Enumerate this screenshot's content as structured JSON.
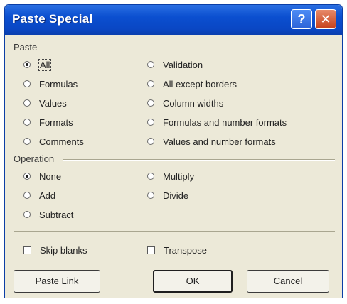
{
  "window": {
    "title": "Paste Special",
    "help_icon": "question-mark",
    "close_icon": "x-mark"
  },
  "paste": {
    "section_label": "Paste",
    "selected": "All",
    "left": [
      {
        "label": "All",
        "mnemonic": "A",
        "selected": true
      },
      {
        "label": "Formulas",
        "mnemonic": "F",
        "selected": false
      },
      {
        "label": "Values",
        "mnemonic": "V",
        "selected": false
      },
      {
        "label": "Formats",
        "mnemonic": "T",
        "selected": false
      },
      {
        "label": "Comments",
        "mnemonic": "C",
        "selected": false
      }
    ],
    "right": [
      {
        "label": "Validation",
        "mnemonic": "N",
        "selected": false
      },
      {
        "label": "All except borders",
        "mnemonic": "X",
        "selected": false
      },
      {
        "label": "Column widths",
        "mnemonic": "W",
        "selected": false
      },
      {
        "label": "Formulas and number formats",
        "mnemonic": "R",
        "selected": false
      },
      {
        "label": "Values and number formats",
        "mnemonic": "U",
        "selected": false
      }
    ]
  },
  "operation": {
    "section_label": "Operation",
    "selected": "None",
    "left": [
      {
        "label": "None",
        "mnemonic": "O",
        "selected": true
      },
      {
        "label": "Add",
        "mnemonic": "D",
        "selected": false
      },
      {
        "label": "Subtract",
        "mnemonic": "S",
        "selected": false
      }
    ],
    "right": [
      {
        "label": "Multiply",
        "mnemonic": "M",
        "selected": false
      },
      {
        "label": "Divide",
        "mnemonic": "I",
        "selected": false
      }
    ]
  },
  "options": {
    "skip_blanks": {
      "label": "Skip blanks",
      "mnemonic": "B",
      "checked": false
    },
    "transpose": {
      "label": "Transpose",
      "mnemonic": "E",
      "checked": false
    }
  },
  "buttons": {
    "paste_link": "Paste Link",
    "ok": "OK",
    "cancel": "Cancel"
  },
  "colors": {
    "titlebar": "#0a47c4",
    "dialog_bg": "#ece9d8",
    "close_button": "#c6401b"
  }
}
